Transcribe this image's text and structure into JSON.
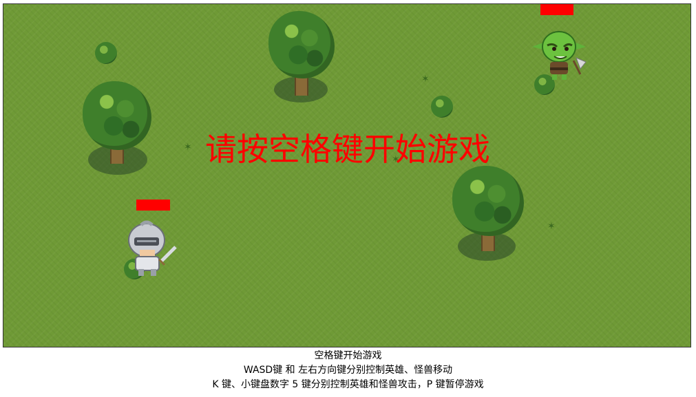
{
  "game": {
    "start_prompt": "请按空格键开始游戏",
    "hero": {
      "name_icon": "knight-icon",
      "health": 1.0
    },
    "monster": {
      "name_icon": "goblin-icon",
      "health": 1.0
    }
  },
  "instructions": {
    "line1": "空格键开始游戏",
    "line2": "WASD键 和 左右方向键分别控制英雄、怪兽移动",
    "line3": "K 键、小键盘数字 5 键分别控制英雄和怪兽攻击，P 键暂停游戏"
  },
  "colors": {
    "grass": "#6f9a36",
    "health": "#ff0000",
    "prompt": "#ff0000"
  }
}
